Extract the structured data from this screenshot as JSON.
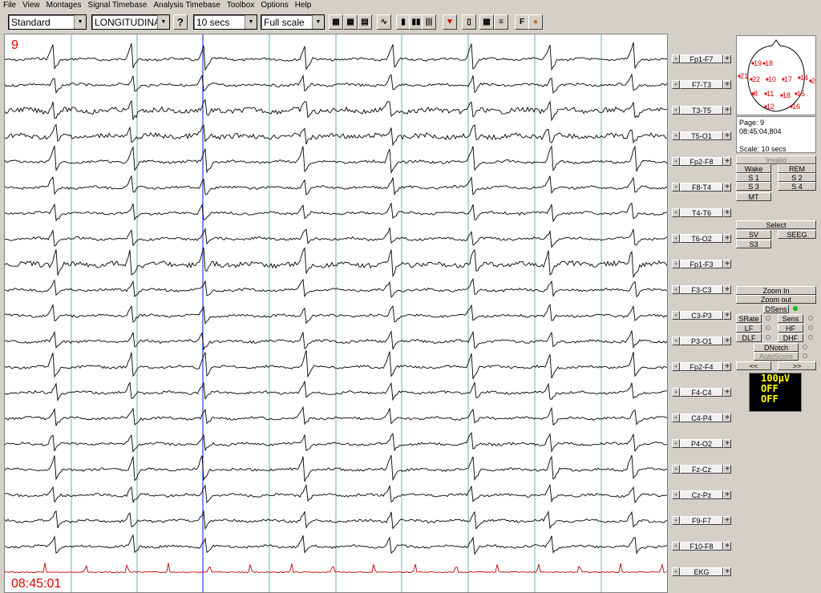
{
  "menu": [
    "File",
    "View",
    "Montages",
    "Signal Timebase",
    "Analysis Timebase",
    "Toolbox",
    "Options",
    "Help"
  ],
  "toolbar": {
    "montage_set": "Standard",
    "montage": "LONGITUDINA",
    "help_label": "?",
    "timebase": "10 secs",
    "scale": "Full scale",
    "f_label": "F"
  },
  "trace": {
    "page": "9",
    "time": "08:45:01"
  },
  "channels": [
    "Fp1-F7",
    "F7-T3",
    "T3-T5",
    "T5-O1",
    "Fp2-F8",
    "F8-T4",
    "T4-T6",
    "T6-O2",
    "Fp1-F3",
    "F3-C3",
    "C3-P3",
    "P3-O1",
    "Fp2-F4",
    "F4-C4",
    "C4-P4",
    "P4-O2",
    "Fz-Cz",
    "Cz-Pz",
    "F9-F7",
    "F10-F8",
    "EKG"
  ],
  "channel_minus": "-",
  "channel_plus": "+",
  "head_map": {
    "electrodes": [
      "19",
      "18",
      "21",
      "22",
      "10",
      "17",
      "14",
      "20",
      "8",
      "11",
      "18",
      "15",
      "12",
      "16"
    ]
  },
  "info": {
    "page": "Page: 9",
    "time": "08:45:04,804",
    "scale": "Scale: 10 secs"
  },
  "staging": {
    "invalid": "Invalid",
    "wake": "Wake",
    "rem": "REM",
    "s1": "S 1",
    "s2": "S 2",
    "s3": "S 3",
    "s4": "S 4",
    "mt": "MT"
  },
  "select": {
    "select": "Select",
    "sv": "SV",
    "seeg": "SEEG",
    "s3": "S3"
  },
  "zoom": {
    "zoom_in": "Zoom In",
    "zoom_out": "Zoom out",
    "dsens": "DSens",
    "srate": "SRate",
    "sens": "Sens",
    "lf": "LF",
    "hf": "HF",
    "dlf": "DLF",
    "dhf": "DHF",
    "dnotch": "DNotch",
    "autoscore": "AutoScore",
    "prev": "<<",
    "next": ">>"
  },
  "amp_display": [
    "100μV",
    "OFF",
    "OFF"
  ],
  "colors": {
    "trace": "#000000",
    "ekg": "#c00000",
    "grid": "#3aa0a0",
    "cursor": "#2040ff",
    "label_red": "#e00000",
    "display_text": "#ffff00"
  }
}
